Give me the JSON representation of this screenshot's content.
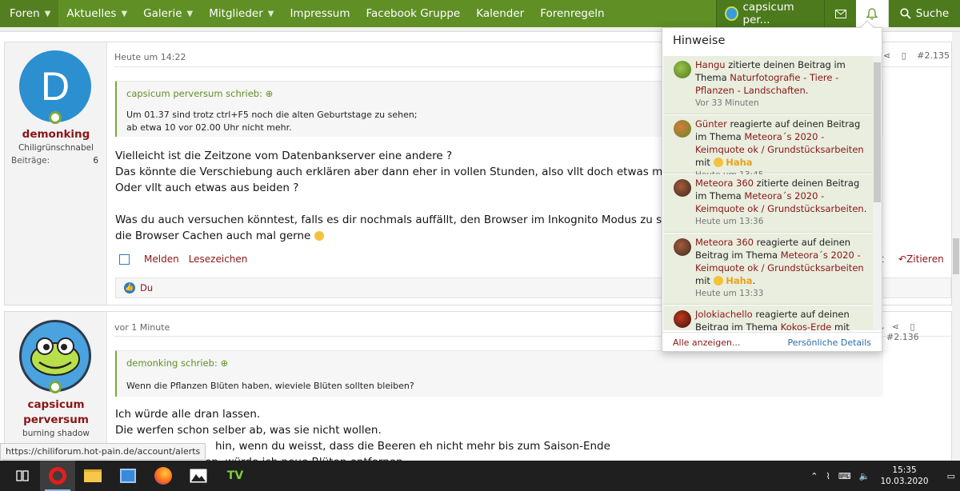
{
  "nav": {
    "items": [
      "Foren",
      "Aktuelles",
      "Galerie",
      "Mitglieder",
      "Impressum",
      "Facebook Gruppe",
      "Kalender",
      "Forenregeln"
    ],
    "user_label": "capsicum per...",
    "search_label": "Suche"
  },
  "post1": {
    "username": "demonking",
    "avatar_letter": "D",
    "user_title": "Chiligrünschnabel",
    "stat_label": "Beiträge:",
    "stat_value": "6",
    "date": "Heute um 14:22",
    "number": "#2.135",
    "quote_author": "capsicum perversum schrieb:",
    "quote_lines": [
      "Um 01.37 sind trotz ctrl+F5 noch die alten Geburtstage zu sehen;",
      "ab etwa 10 vor 02.00 Uhr nicht mehr."
    ],
    "text_lines": [
      "Vielleicht ist die Zeitzone vom Datenbankserver eine andere ?",
      "Das könnte die Verschiebung auch erklären aber dann eher in vollen Stunden, also vllt doch etwas mit dem Cache",
      "Oder vllt auch etwas aus beiden ?",
      "",
      "Was du auch versuchen könntest, falls es dir nochmals auffällt, den Browser im Inkognito Modus zu starten und d",
      "die Browser Cachen auch mal gerne"
    ],
    "action_report": "Melden",
    "action_bookmark": "Lesezeichen",
    "action_tail": "t",
    "action_quote": "Zitieren",
    "likes": "Du"
  },
  "post2": {
    "username_line1": "capsicum",
    "username_line2": "perversum",
    "user_title": "burning shadow",
    "date": "vor 1 Minute",
    "number": "#2.136",
    "quote_author": "demonking schrieb:",
    "quote_lines": [
      "Wenn die Pflanzen Blüten haben, wieviele Blüten sollten bleiben?"
    ],
    "text_lines": [
      "Ich würde alle dran lassen.",
      "Die werfen schon selber ab, was sie nicht wollen.",
      "hin, wenn du weisst, dass die Beeren eh nicht mehr bis zum Saison-Ende",
      "en, würde ich neue Blüten entfernen."
    ]
  },
  "popup": {
    "title": "Hinweise",
    "alerts": [
      {
        "user": "Hangu",
        "pre": " zitierte deinen Beitrag im Thema ",
        "thread": "Naturfotografie - Tiere - Pflanzen - Landschaften",
        "post": ".",
        "reaction": "",
        "time": "Vor 33 Minuten"
      },
      {
        "user": "Günter",
        "pre": " reagierte auf deinen Beitrag im Thema ",
        "thread": "Meteora´s 2020 - Keimquote ok / Grundstücksarbeiten",
        "post": " mit ",
        "reaction": "Haha",
        "time": "Heute um 13:45"
      },
      {
        "user": "Meteora 360",
        "pre": " zitierte deinen Beitrag im Thema ",
        "thread": "Meteora´s 2020 - Keimquote ok / Grundstücksarbeiten",
        "post": ".",
        "reaction": "",
        "time": "Heute um 13:36"
      },
      {
        "user": "Meteora 360",
        "pre": " reagierte auf deinen Beitrag im Thema ",
        "thread": "Meteora´s 2020 - Keimquote ok / Grundstücksarbeiten",
        "post": " mit ",
        "reaction": "Haha",
        "time": "Heute um 13:33"
      },
      {
        "user": "Jolokiachello",
        "pre": " reagierte auf deinen Beitrag im Thema ",
        "thread": "Kokos-Erde",
        "post": " mit",
        "reaction": "",
        "time": ""
      }
    ],
    "show_all": "Alle anzeigen...",
    "personal": "Persönliche Details"
  },
  "status_url": "https://chiliforum.hot-pain.de/account/alerts",
  "taskbar": {
    "time": "15:35",
    "date": "10.03.2020",
    "tv_label": "TV"
  },
  "colors": {
    "nav_green": "#5f8f25",
    "username_red": "#8a1515",
    "alert_bg": "#e9eedf"
  }
}
